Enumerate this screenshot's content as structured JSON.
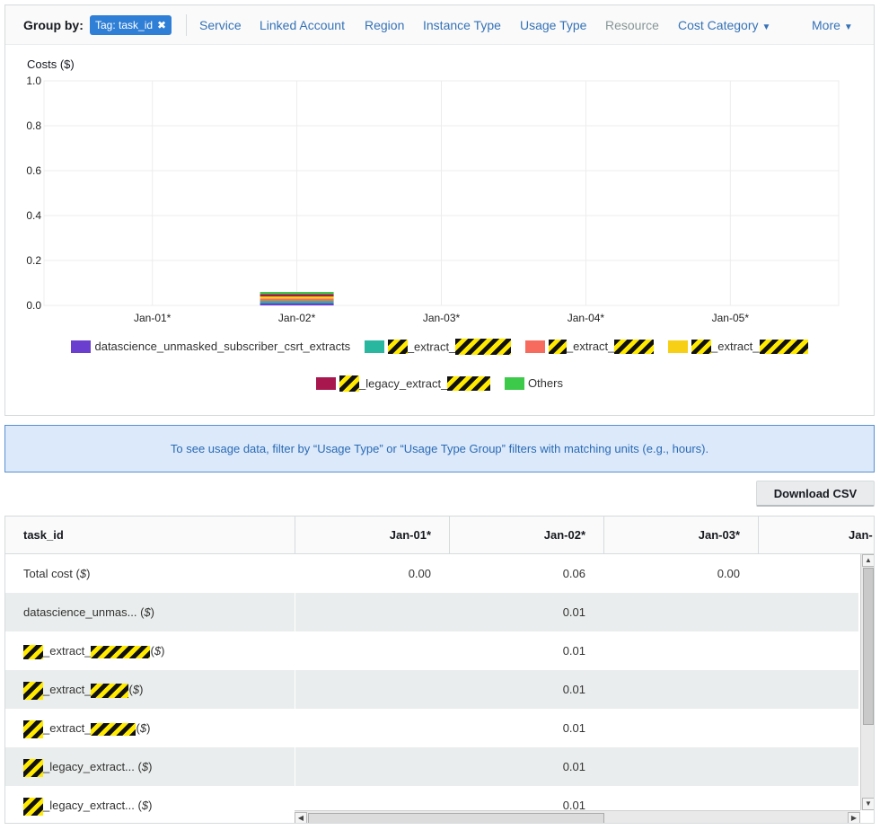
{
  "groupby": {
    "label": "Group by:",
    "tag_chip": "Tag: task_id",
    "tag_remove": "✖",
    "links": [
      "Service",
      "Linked Account",
      "Region",
      "Instance Type",
      "Usage Type",
      "Resource",
      "Cost Category",
      "More"
    ]
  },
  "chart_data": {
    "type": "bar",
    "ylabel": "Costs ($)",
    "categories": [
      "Jan-01*",
      "Jan-02*",
      "Jan-03*",
      "Jan-04*",
      "Jan-05*"
    ],
    "ylim": [
      0,
      1.0
    ],
    "yticks": [
      "1.0",
      "0.8",
      "0.6",
      "0.4",
      "0.2",
      "0.0"
    ],
    "yvalues": [
      1.0,
      0.8,
      0.6,
      0.4,
      0.2,
      0.0
    ],
    "stacked": true,
    "grid": true,
    "legend_position": "bottom",
    "series": [
      {
        "name": "datascience_unmasked_subscriber_csrt_extracts",
        "color": "#6a3fcf",
        "values": [
          0,
          0.01,
          0,
          0,
          0
        ]
      },
      {
        "name": "_extract_",
        "color": "#2ab7a0",
        "values": [
          0,
          0.01,
          0,
          0,
          0
        ]
      },
      {
        "name": "_extract_",
        "color": "#f76b5f",
        "values": [
          0,
          0.01,
          0,
          0,
          0
        ]
      },
      {
        "name": "_extract_",
        "color": "#f7cf14",
        "values": [
          0,
          0.01,
          0,
          0,
          0
        ]
      },
      {
        "name": "_legacy_extract_",
        "color": "#a8184e",
        "values": [
          0,
          0.01,
          0,
          0,
          0
        ]
      },
      {
        "name": "Others",
        "color": "#3dc94a",
        "values": [
          0,
          0.01,
          0,
          0,
          0
        ]
      }
    ]
  },
  "info_banner": "To see usage data, filter by “Usage Type” or “Usage Type Group” filters with matching units (e.g., hours).",
  "download_label": "Download CSV",
  "table": {
    "columns": [
      "task_id",
      "Jan-01*",
      "Jan-02*",
      "Jan-03*",
      "Jan-"
    ],
    "unit": "($)",
    "rows": [
      {
        "label": "Total cost",
        "values": [
          "0.00",
          "0.06",
          "0.00"
        ]
      },
      {
        "label": "datascience_unmas...",
        "values": [
          "",
          "0.01",
          ""
        ]
      },
      {
        "label": "_extract_",
        "values": [
          "",
          "0.01",
          ""
        ]
      },
      {
        "label": "_extract_",
        "values": [
          "",
          "0.01",
          ""
        ]
      },
      {
        "label": "_extract_",
        "values": [
          "",
          "0.01",
          ""
        ]
      },
      {
        "label": "_legacy_extract...",
        "values": [
          "",
          "0.01",
          ""
        ]
      },
      {
        "label": "_legacy_extract...",
        "values": [
          "",
          "0.01",
          ""
        ]
      }
    ]
  }
}
